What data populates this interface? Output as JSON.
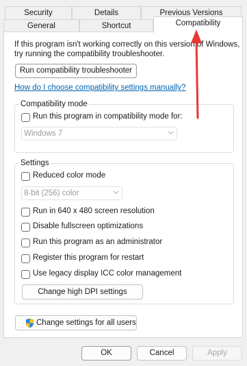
{
  "tabs": {
    "security": "Security",
    "details": "Details",
    "previous_versions": "Previous Versions",
    "general": "General",
    "shortcut": "Shortcut",
    "compatibility": "Compatibility"
  },
  "intro_line1": "If this program isn't working correctly on this version of Windows,",
  "intro_line2": "try running the compatibility troubleshooter.",
  "troubleshooter_button": "Run compatibility troubleshooter",
  "manual_link": "How do I choose compatibility settings manually?",
  "compat_mode": {
    "legend": "Compatibility mode",
    "checkbox_label": "Run this program in compatibility mode for:",
    "selected_os": "Windows 7"
  },
  "settings": {
    "legend": "Settings",
    "reduced_color": "Reduced color mode",
    "color_option": "8-bit (256) color",
    "res_640": "Run in 640 x 480 screen resolution",
    "disable_fullscreen": "Disable fullscreen optimizations",
    "run_admin": "Run this program as an administrator",
    "register_restart": "Register this program for restart",
    "legacy_icc": "Use legacy display ICC color management",
    "dpi_button": "Change high DPI settings"
  },
  "change_all_users_button": "Change settings for all users",
  "footer": {
    "ok": "OK",
    "cancel": "Cancel",
    "apply": "Apply"
  },
  "colors": {
    "link": "#0063b1",
    "annotation_arrow": "#e53935",
    "shield_blue": "#1e88e5",
    "shield_yellow": "#f9c31c"
  },
  "icons": [
    "shield-icon",
    "chevron-down-icon",
    "annotation-arrow"
  ]
}
